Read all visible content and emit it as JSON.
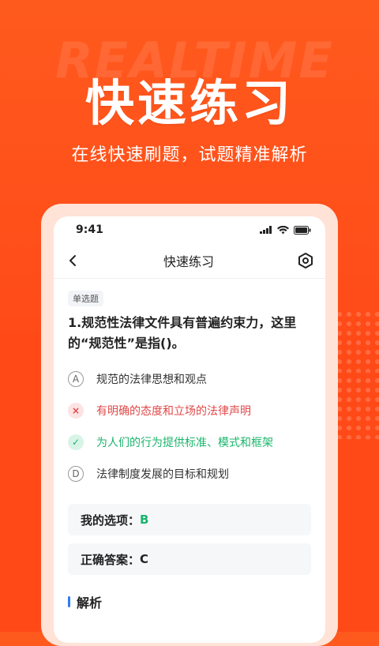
{
  "banner": {
    "watermark": "REALTIME",
    "title": "快速练习",
    "subtitle": "在线快速刷题，试题精准解析"
  },
  "phone": {
    "status_time": "9:41",
    "nav_title": "快速练习",
    "question_type": "单选题",
    "question": "1.规范性法律文件具有普遍约束力，这里的“规范性”是指()。",
    "options": [
      {
        "letter": "A",
        "text": "规范的法律思想和观点",
        "state": "normal"
      },
      {
        "letter": "×",
        "text": "有明确的态度和立场的法律声明",
        "state": "wrong"
      },
      {
        "letter": "✓",
        "text": "为人们的行为提供标准、模式和框架",
        "state": "right"
      },
      {
        "letter": "D",
        "text": "法律制度发展的目标和规划",
        "state": "normal"
      }
    ],
    "my_choice_label": "我的选项：",
    "my_choice_value": "B",
    "correct_label": "正确答案：",
    "correct_value": "C",
    "analysis_title": "解析"
  },
  "colors": {
    "brand": "#ff4a18",
    "wrong": "#e04848",
    "right": "#19b56b",
    "accent": "#2f7cf6"
  }
}
